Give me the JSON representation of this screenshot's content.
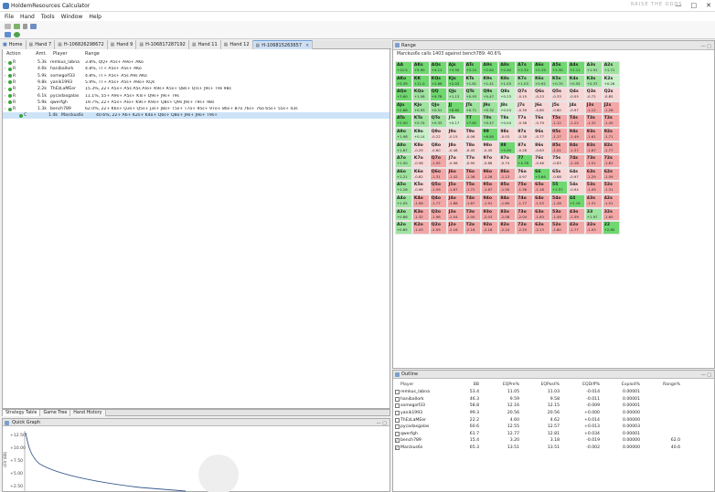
{
  "app": {
    "title": "HoldemResources Calculator",
    "brand_watermark": "RAISE  THE  ODDS"
  },
  "menu": [
    "File",
    "Hand",
    "Tools",
    "Window",
    "Help"
  ],
  "tabs": [
    {
      "label": "Home",
      "active": false
    },
    {
      "label": "Hand 7",
      "active": false
    },
    {
      "label": "H-106826298672",
      "active": false
    },
    {
      "label": "Hand 9",
      "active": false
    },
    {
      "label": "H-106817287192",
      "active": false
    },
    {
      "label": "Hand 11",
      "active": false
    },
    {
      "label": "Hand 12",
      "active": false
    },
    {
      "label": "H-106815263657",
      "active": true
    }
  ],
  "action_table": {
    "headers": [
      "Action",
      "Amt.",
      "Player",
      "Range"
    ],
    "rows": [
      {
        "action": "R",
        "amt": "5.3k",
        "player": "remkus_labna",
        "range": "3.8%, QQ+ A5s+ A9o+ AKo"
      },
      {
        "action": "R",
        "amt": "4.6k",
        "player": "haniballork",
        "range": "4.8%, TT+ A5s+ A5s+ AKo"
      },
      {
        "action": "R",
        "amt": "5.9k",
        "player": "somegolf33",
        "range": "4.8%, TT+ A5s+ A5s A9s AKo"
      },
      {
        "action": "R",
        "amt": "9.8k",
        "player": "yanik1993",
        "range": "5.9%, TT+ A5s+ A5s+ A9o+ KQs"
      },
      {
        "action": "R",
        "amt": "2.2k",
        "player": "ThEzLaMEer",
        "range": "15.3%, 22+ A5s+ A5s A5s ATo+ K9s+ K5s+ Q8s+ QTs+ J9s+ T9s 98s"
      },
      {
        "action": "R",
        "amt": "6.1k",
        "player": "pycadasgalas",
        "range": "11.1%, 55+ A9s+ A5s+ KTs+ Q9s+ J9s+ T9s"
      },
      {
        "action": "R",
        "amt": "5.9k",
        "player": "qwerfgh",
        "range": "19.7%, 22+ A5s+ ATo+ K9s+ K9o+ Q8s+ Q9s J9s+ T9s+ 98s"
      },
      {
        "action": "R",
        "amt": "1.3k",
        "player": "bench789",
        "range": "62.0%, 22+ K6s+ Q3s+ Q5s+ J3s+ J8o+ T5s+ T7o+ 95s+ 97o+ 86s+ 87o 76s+ 76o 65s+ 55s+ 43s"
      },
      {
        "action": "C",
        "amt": "1.4k",
        "player": "Marckus6s",
        "range": "40.6%, 22+ A6+ K2s+ K4o+ Q6s+ Q8o+ J9s+ J9o+ T9s+",
        "selected": true
      }
    ]
  },
  "bottom_tabs": [
    "Strategy Table",
    "Game Tree",
    "Hand History"
  ],
  "quick_graph": {
    "title": "Quick Graph",
    "y_label": "cEV (BB)",
    "ticks": [
      "+12.50",
      "+10.00",
      "+7.50",
      "+5.00",
      "+2.50"
    ]
  },
  "range_panel": {
    "title": "Range",
    "subtitle": "Marckus6s calls 1403 against bench789: 40.6%",
    "grid": [
      [
        [
          "AA",
          "+12.5"
        ],
        [
          "AKs",
          "+5.90"
        ],
        [
          "AQs",
          "+4.11"
        ],
        [
          "AJs",
          "+3.50"
        ],
        [
          "ATs",
          "+3.10"
        ],
        [
          "A9s",
          "+2.62"
        ],
        [
          "A8s",
          "+2.40"
        ],
        [
          "A7s",
          "+2.32"
        ],
        [
          "A6s",
          "+2.19"
        ],
        [
          "A5s",
          "+2.30"
        ],
        [
          "A4s",
          "+2.11"
        ],
        [
          "A3s",
          "+1.91"
        ],
        [
          "A2s",
          "+1.71"
        ]
      ],
      [
        [
          "AKo",
          "+5.39"
        ],
        [
          "KK",
          "+11.0"
        ],
        [
          "KQs",
          "+2.68"
        ],
        [
          "KJs",
          "+2.03"
        ],
        [
          "KTs",
          "+1.81"
        ],
        [
          "K9s",
          "+1.41"
        ],
        [
          "K8s",
          "+1.03"
        ],
        [
          "K7s",
          "+1.03"
        ],
        [
          "K6s",
          "+0.92"
        ],
        [
          "K5s",
          "+0.70"
        ],
        [
          "K4s",
          "+0.55"
        ],
        [
          "K3s",
          "+0.37"
        ],
        [
          "K2s",
          "+0.26"
        ]
      ],
      [
        [
          "AQo",
          "+3.60"
        ],
        [
          "KQo",
          "+1.58"
        ],
        [
          "QQ",
          "+9.78"
        ],
        [
          "QJs",
          "+1.13"
        ],
        [
          "QTs",
          "+0.93"
        ],
        [
          "Q9s",
          "+0.47"
        ],
        [
          "Q8s",
          "+0.23"
        ],
        [
          "Q7s",
          "-0.15"
        ],
        [
          "Q6s",
          "-0.23"
        ],
        [
          "Q5s",
          "-0.33"
        ],
        [
          "Q4s",
          "-0.55"
        ],
        [
          "Q3s",
          "-0.72"
        ],
        [
          "Q2s",
          "-0.85"
        ]
      ],
      [
        [
          "AJo",
          "+2.86"
        ],
        [
          "KJo",
          "+0.93"
        ],
        [
          "QJo",
          "+0.51"
        ],
        [
          "JJ",
          "+8.60"
        ],
        [
          "JTs",
          "+0.71"
        ],
        [
          "J9s",
          "+0.32"
        ],
        [
          "J8s",
          "+0.04"
        ],
        [
          "J7s",
          "-0.39"
        ],
        [
          "J6s",
          "-0.60"
        ],
        [
          "J5s",
          "-0.80"
        ],
        [
          "J4s",
          "-0.97"
        ],
        [
          "J3s",
          "-1.12"
        ],
        [
          "J2s",
          "-1.26"
        ]
      ],
      [
        [
          "ATo",
          "+2.50"
        ],
        [
          "KTo",
          "+0.74"
        ],
        [
          "QTo",
          "+0.33"
        ],
        [
          "JTo",
          "+0.17"
        ],
        [
          "TT",
          "+7.82"
        ],
        [
          "T9s",
          "+0.47"
        ],
        [
          "T8s",
          "+0.04"
        ],
        [
          "T7s",
          "-0.38"
        ],
        [
          "T6s",
          "-0.79"
        ],
        [
          "T5s",
          "-1.12"
        ],
        [
          "T4s",
          "-1.22"
        ],
        [
          "T3s",
          "-1.32"
        ],
        [
          "T2s",
          "-1.45"
        ]
      ],
      [
        [
          "A9o",
          "+1.98"
        ],
        [
          "K9o",
          "+0.14"
        ],
        [
          "Q9o",
          "-0.22"
        ],
        [
          "J9o",
          "-0.15"
        ],
        [
          "T9o",
          "-0.06"
        ],
        [
          "99",
          "+6.80"
        ],
        [
          "98s",
          "-0.03"
        ],
        [
          "97s",
          "-0.38"
        ],
        [
          "96s",
          "-0.77"
        ],
        [
          "95s",
          "-1.17"
        ],
        [
          "94s",
          "-1.49"
        ],
        [
          "93s",
          "-1.61"
        ],
        [
          "92s",
          "-1.71"
        ]
      ],
      [
        [
          "A8o",
          "+1.67"
        ],
        [
          "K8o",
          "-0.29"
        ],
        [
          "Q8o",
          "-0.60"
        ],
        [
          "J8o",
          "-0.48"
        ],
        [
          "T8o",
          "-0.45"
        ],
        [
          "98o",
          "-0.45"
        ],
        [
          "88",
          "+5.90"
        ],
        [
          "87s",
          "-0.28"
        ],
        [
          "86s",
          "-0.63"
        ],
        [
          "85s",
          "-1.01"
        ],
        [
          "84s",
          "-1.37"
        ],
        [
          "83s",
          "-1.67"
        ],
        [
          "82s",
          "-1.77"
        ]
      ],
      [
        [
          "A7o",
          "+1.50"
        ],
        [
          "K7o",
          "-0.58"
        ],
        [
          "Q7o",
          "-1.05"
        ],
        [
          "J7o",
          "-0.98"
        ],
        [
          "T7o",
          "-0.90"
        ],
        [
          "97o",
          "-0.88"
        ],
        [
          "87o",
          "-0.74"
        ],
        [
          "77",
          "+4.78"
        ],
        [
          "76s",
          "-0.46"
        ],
        [
          "75s",
          "-0.83"
        ],
        [
          "74s",
          "-1.18"
        ],
        [
          "73s",
          "-1.51"
        ],
        [
          "72s",
          "-1.81"
        ]
      ],
      [
        [
          "A6o",
          "+1.21"
        ],
        [
          "K6o",
          "-0.82"
        ],
        [
          "Q6o",
          "-1.31"
        ],
        [
          "J6o",
          "-1.42"
        ],
        [
          "T6o",
          "-1.36"
        ],
        [
          "96o",
          "-1.26"
        ],
        [
          "86o",
          "-1.13"
        ],
        [
          "76o",
          "-0.97"
        ],
        [
          "66",
          "+3.66"
        ],
        [
          "65s",
          "-0.68"
        ],
        [
          "64s",
          "-0.97"
        ],
        [
          "63s",
          "-1.29"
        ],
        [
          "62s",
          "-1.59"
        ]
      ],
      [
        [
          "A5o",
          "+1.26"
        ],
        [
          "K5o",
          "-0.98"
        ],
        [
          "Q5o",
          "-1.59"
        ],
        [
          "J5o",
          "-1.67"
        ],
        [
          "T5o",
          "-1.72"
        ],
        [
          "95o",
          "-1.67"
        ],
        [
          "85o",
          "-1.50"
        ],
        [
          "75o",
          "-1.36"
        ],
        [
          "65o",
          "-1.18"
        ],
        [
          "55",
          "+2.57"
        ],
        [
          "54s",
          "-0.94"
        ],
        [
          "53s",
          "-1.09"
        ],
        [
          "52s",
          "-1.31"
        ]
      ],
      [
        [
          "A4o",
          "+1.05"
        ],
        [
          "K4o",
          "-1.08"
        ],
        [
          "Q4o",
          "-1.77"
        ],
        [
          "J4o",
          "-1.86"
        ],
        [
          "T4o",
          "-1.87"
        ],
        [
          "94o",
          "-1.91"
        ],
        [
          "84o",
          "-1.89"
        ],
        [
          "74o",
          "-1.77"
        ],
        [
          "64o",
          "-1.53"
        ],
        [
          "54o",
          "-1.28"
        ],
        [
          "44",
          "+2.19"
        ],
        [
          "43s",
          "-1.31"
        ],
        [
          "42s",
          "-1.51"
        ]
      ],
      [
        [
          "A3o",
          "+0.86"
        ],
        [
          "K3o",
          "-1.32"
        ],
        [
          "Q3o",
          "-1.96"
        ],
        [
          "J3o",
          "-2.04"
        ],
        [
          "T3o",
          "-2.00"
        ],
        [
          "93o",
          "-2.03"
        ],
        [
          "83o",
          "-2.08"
        ],
        [
          "73o",
          "-2.04"
        ],
        [
          "63o",
          "-1.83"
        ],
        [
          "53o",
          "-1.49"
        ],
        [
          "43o",
          "-1.59"
        ],
        [
          "33",
          "+1.97"
        ],
        [
          "32s",
          "-1.60"
        ]
      ],
      [
        [
          "A2o",
          "+0.65"
        ],
        [
          "K2o",
          "-1.43"
        ],
        [
          "Q2o",
          "-2.09"
        ],
        [
          "J2o",
          "-2.16"
        ],
        [
          "T2o",
          "-2.18"
        ],
        [
          "92o",
          "-2.18"
        ],
        [
          "82o",
          "-2.24"
        ],
        [
          "72o",
          "-2.25"
        ],
        [
          "62o",
          "-2.13"
        ],
        [
          "52o",
          "-1.80"
        ],
        [
          "42o",
          "-1.77"
        ],
        [
          "32o",
          "-1.93"
        ],
        [
          "22",
          "+2.80"
        ]
      ]
    ]
  },
  "outline": {
    "title": "Outline",
    "headers": [
      "Player",
      "BB",
      "EQPre%",
      "EQPost%",
      "EQDiff%",
      "Exploit%",
      "Range%"
    ],
    "rows": [
      {
        "player": "remkus_labna",
        "bb": "53.4",
        "eqpre": "11.05",
        "eqpost": "11.03",
        "eqdiff": "-0.014",
        "exploit": "0.00001",
        "range": "",
        "checked": false
      },
      {
        "player": "haniballork",
        "bb": "46.3",
        "eqpre": "9.59",
        "eqpost": "9.58",
        "eqdiff": "-0.011",
        "exploit": "0.00001",
        "range": "",
        "checked": false
      },
      {
        "player": "somegolf33",
        "bb": "58.8",
        "eqpre": "12.16",
        "eqpost": "12.15",
        "eqdiff": "-0.009",
        "exploit": "0.00001",
        "range": "",
        "checked": false
      },
      {
        "player": "yanik1993",
        "bb": "99.3",
        "eqpre": "20.56",
        "eqpost": "20.56",
        "eqdiff": "+0.000",
        "exploit": "0.00000",
        "range": "",
        "checked": false
      },
      {
        "player": "ThEzLaMEer",
        "bb": "22.2",
        "eqpre": "4.60",
        "eqpost": "4.62",
        "eqdiff": "+0.014",
        "exploit": "0.00000",
        "range": "",
        "checked": false
      },
      {
        "player": "pycadasgalas",
        "bb": "60.6",
        "eqpre": "12.55",
        "eqpost": "12.57",
        "eqdiff": "+0.013",
        "exploit": "0.00003",
        "range": "",
        "checked": false
      },
      {
        "player": "qwerfgh",
        "bb": "61.7",
        "eqpre": "12.77",
        "eqpost": "12.81",
        "eqdiff": "+0.034",
        "exploit": "0.00001",
        "range": "",
        "checked": false
      },
      {
        "player": "bench789",
        "bb": "15.4",
        "eqpre": "3.20",
        "eqpost": "3.18",
        "eqdiff": "-0.019",
        "exploit": "0.00000",
        "range": "62.0",
        "checked": true
      },
      {
        "player": "Marckus6s",
        "bb": "65.3",
        "eqpre": "13.51",
        "eqpost": "13.51",
        "eqdiff": "-0.002",
        "exploit": "0.00000",
        "range": "40.6",
        "checked": true
      }
    ]
  },
  "colors": {
    "call_strong": "#6fd86f",
    "call_light": "#c9f0c9",
    "fold_light": "#f9d6d6",
    "fold_strong": "#f4a7a7",
    "selection": "#cde3f8"
  }
}
